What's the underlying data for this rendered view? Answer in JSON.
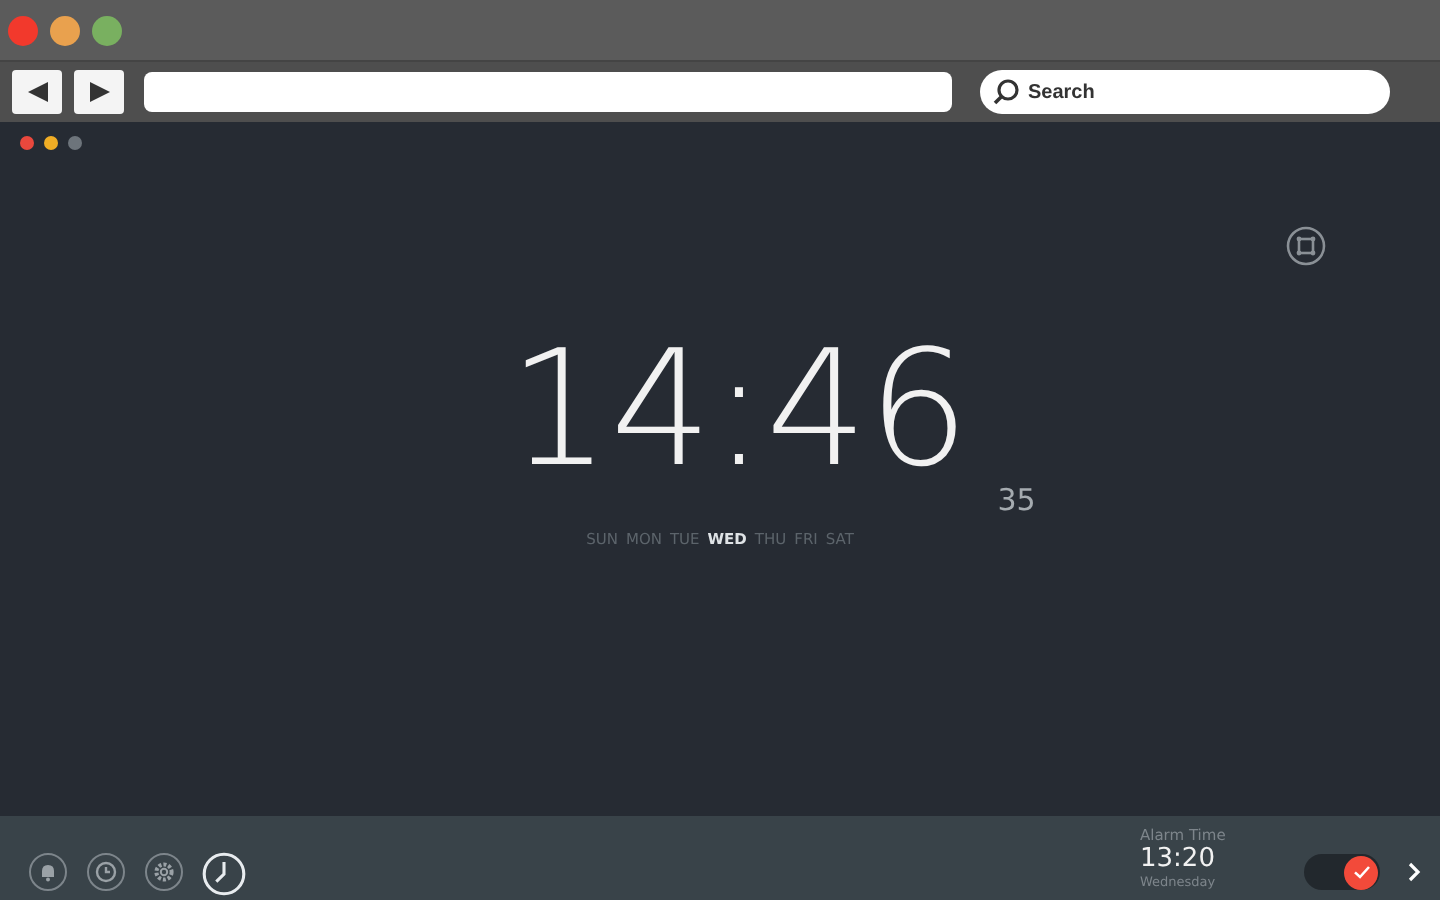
{
  "browser": {
    "search": {
      "placeholder": "Search"
    }
  },
  "clock": {
    "time": "14:46",
    "seconds": "35",
    "days": [
      {
        "label": "SUN",
        "selected": false
      },
      {
        "label": "MON",
        "selected": false
      },
      {
        "label": "TUE",
        "selected": false
      },
      {
        "label": "WED",
        "selected": true
      },
      {
        "label": "THU",
        "selected": false
      },
      {
        "label": "FRI",
        "selected": false
      },
      {
        "label": "SAT",
        "selected": false
      }
    ]
  },
  "bottom_bar": {
    "tools": [
      {
        "kind": "bell",
        "selected": false
      },
      {
        "kind": "timer",
        "selected": false
      },
      {
        "kind": "gear",
        "selected": false
      },
      {
        "kind": "clock",
        "selected": true
      }
    ],
    "alarm": {
      "label": "Alarm Time",
      "time": "13:20",
      "day": "Wednesday",
      "on": true
    }
  }
}
